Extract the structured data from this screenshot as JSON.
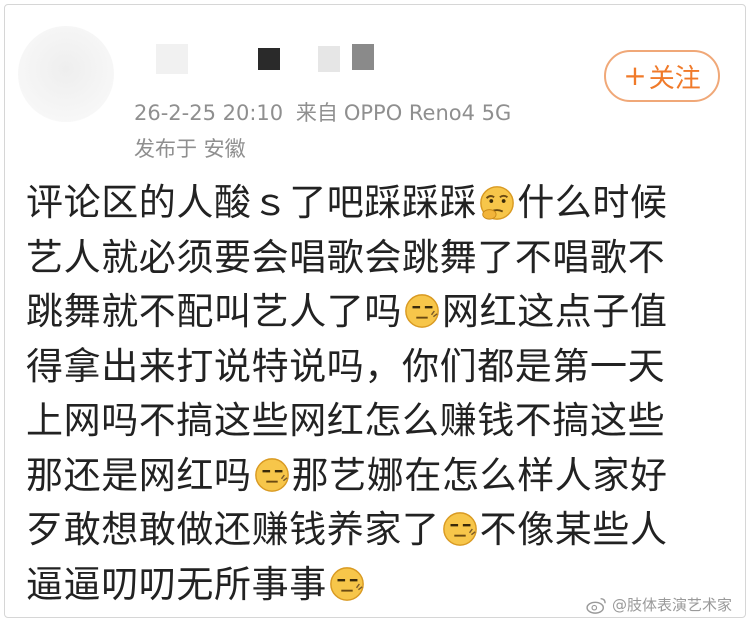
{
  "post": {
    "follow_label": "关注",
    "timestamp": "26-2-25 20:10",
    "source_prefix": "来自",
    "device": "OPPO Reno4 5G",
    "location": "发布于 安徽",
    "lines": [
      "评论区的人酸ｓ了吧踩踩踩",
      "什么时候",
      "艺人就必须要会唱歌会跳舞了不唱歌不",
      "跳舞就不配叫艺人了吗",
      "网红这点子值",
      "得拿出来打说特说吗，你们都是第一天",
      "上网吗不搞这些网红怎么赚钱不搞这些",
      "那还是网红吗",
      "那艺娜在怎么样人家好",
      "歹敢想敢做还赚钱养家了",
      "不像某些人",
      "逼逼叨叨无所事事"
    ]
  },
  "icons": {
    "follow": "plus-icon",
    "emoji_1": "thinking-eyeroll-emoji-icon",
    "emoji_2": "smirk-emoji-icon",
    "watermark": "weibo-logo-icon"
  },
  "watermark": {
    "text": "@肢体表演艺术家"
  },
  "colors": {
    "accent": "#f07a2a",
    "meta_text": "#8f8f8f",
    "body_text": "#222222",
    "emoji_face": "#f7c64a"
  }
}
